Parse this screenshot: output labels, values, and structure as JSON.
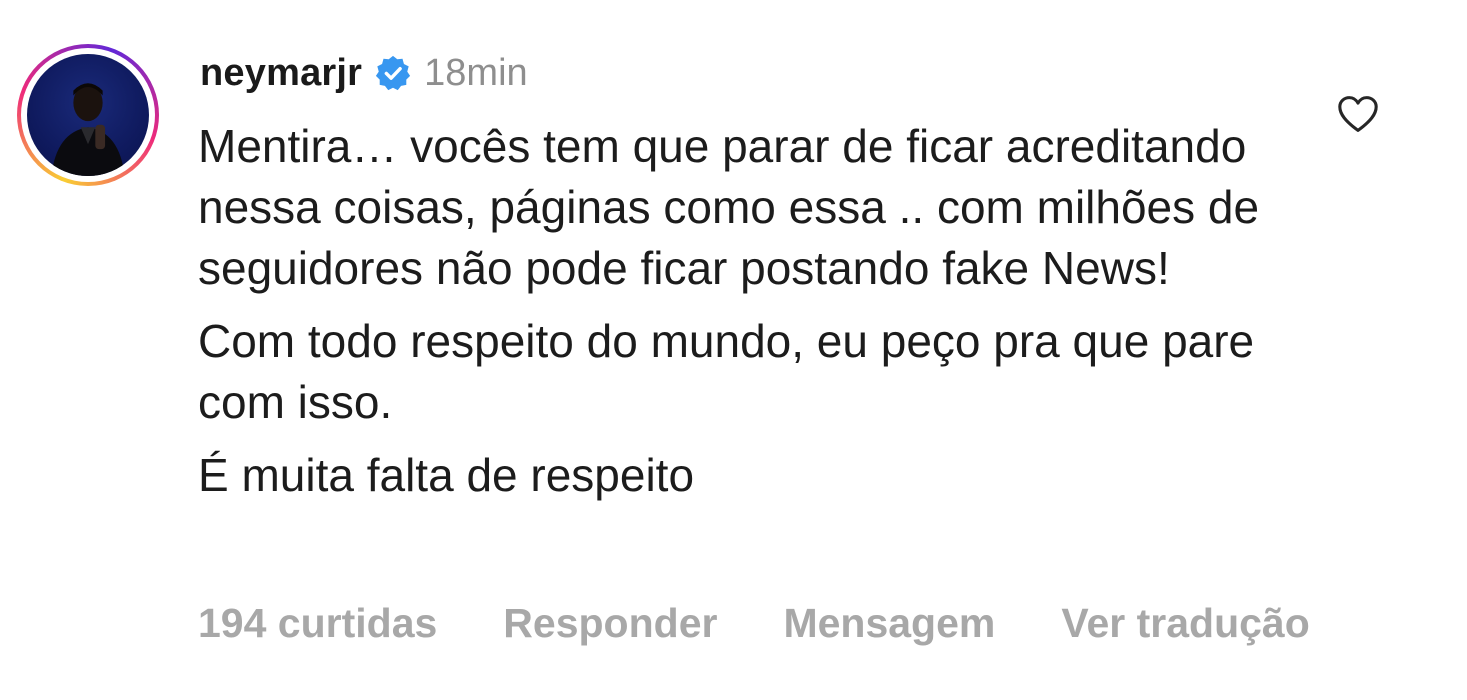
{
  "comment": {
    "username": "neymarjr",
    "verified": true,
    "time": "18min",
    "paragraphs": [
      "Mentira… vocês tem que parar de ficar acreditando nessa coisas, páginas como essa .. com milhões de seguidores não pode ficar postando fake News!",
      "Com todo respeito do mundo, eu peço pra que pare com isso.",
      "É muita falta de respeito"
    ],
    "likes": "194 curtidas",
    "reply_label": "Responder",
    "message_label": "Mensagem",
    "translate_label": "Ver tradução"
  },
  "icons": {
    "verified": "verified-badge-icon",
    "like": "heart-icon"
  },
  "colors": {
    "verified_blue": "#3897f0",
    "muted_text": "#a8a8a8"
  }
}
